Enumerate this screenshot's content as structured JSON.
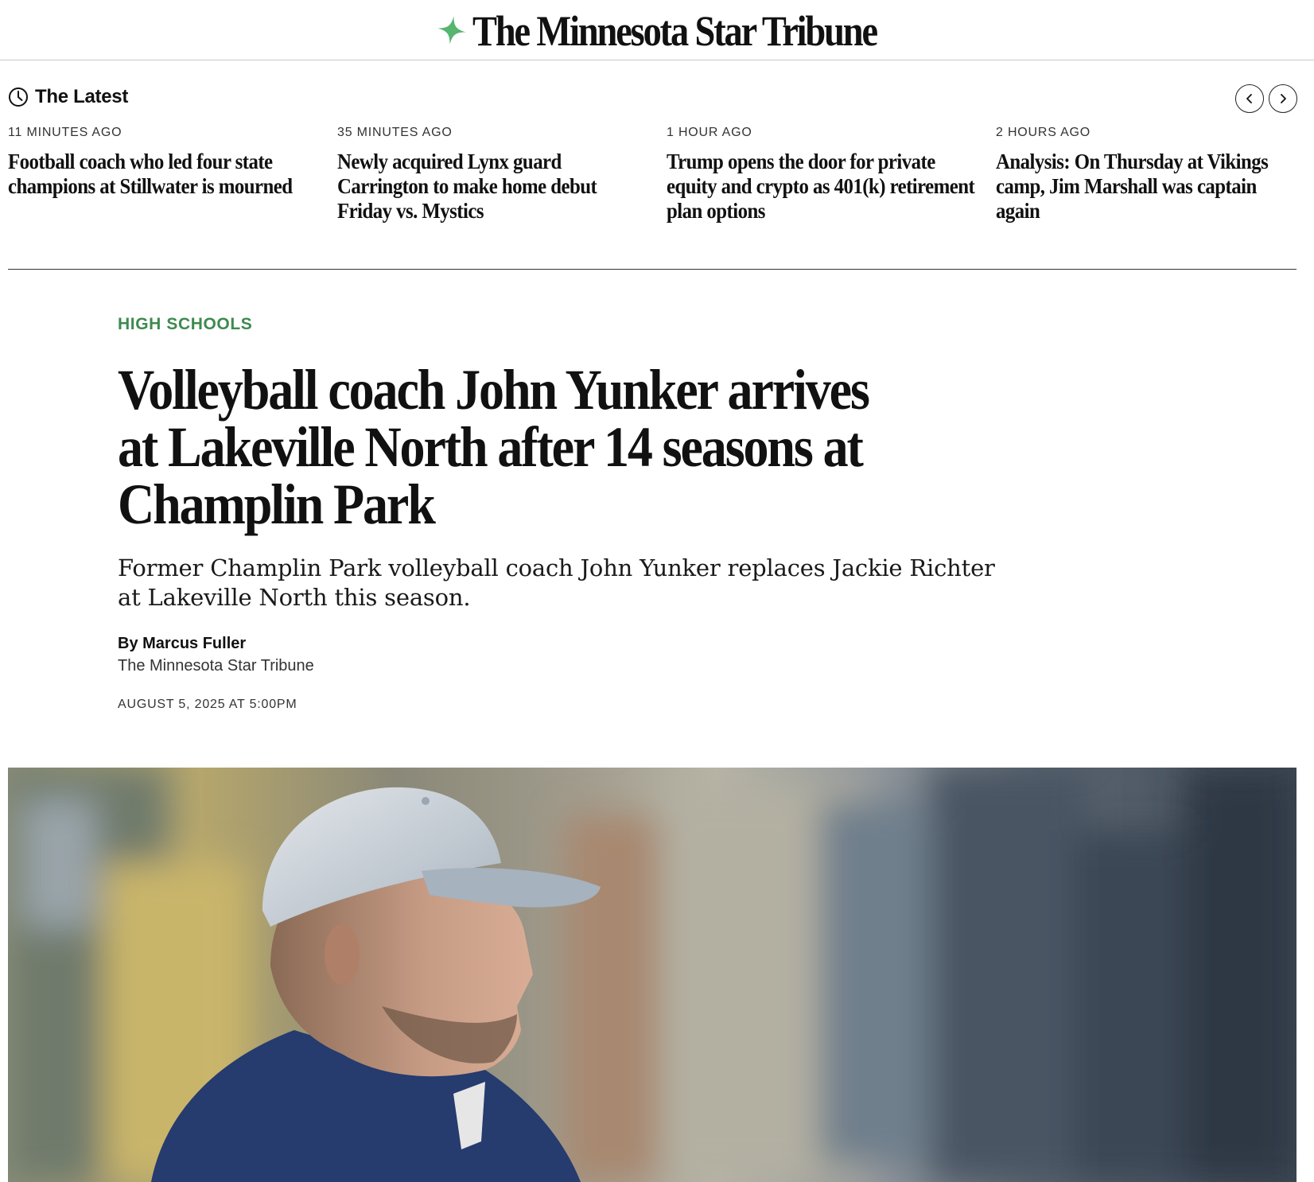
{
  "masthead": {
    "brand": "The Minnesota Star Tribune",
    "accent_color": "#56b56e"
  },
  "latest": {
    "title": "The Latest",
    "icon": "clock-icon",
    "prev_icon": "chevron-left-icon",
    "next_icon": "chevron-right-icon",
    "items": [
      {
        "time": "11 MINUTES AGO",
        "headline": "Football coach who led four state champions at Stillwater is mourned"
      },
      {
        "time": "35 MINUTES AGO",
        "headline": "Newly acquired Lynx guard Carrington to make home debut Friday vs. Mystics"
      },
      {
        "time": "1 HOUR AGO",
        "headline": "Trump opens the door for private equity and crypto as 401(k) retirement plan options"
      },
      {
        "time": "2 HOURS AGO",
        "headline": "Analysis: On Thursday at Vikings camp, Jim Marshall was captain again"
      }
    ]
  },
  "article": {
    "section": "HIGH SCHOOLS",
    "section_color": "#3d8a4f",
    "title": "Volleyball coach John Yunker arrives at Lakeville North after 14 seasons at Champlin Park",
    "dek": "Former Champlin Park volleyball coach John Yunker replaces Jackie Richter at Lakeville North this season.",
    "byline_prefix": "By ",
    "author": "Marcus Fuller",
    "organization": "The Minnesota Star Tribune",
    "date": "AUGUST 5, 2025 AT 5:00PM"
  }
}
